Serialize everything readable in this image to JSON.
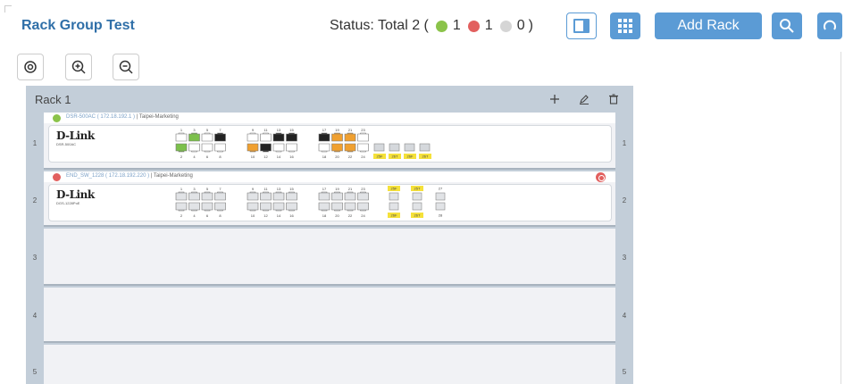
{
  "header": {
    "title": "Rack Group Test",
    "status_label": "Status: Total 2 (",
    "status_green_count": "1",
    "status_red_count": "1",
    "status_gray_count": "0",
    "status_close": ")",
    "add_rack_label": "Add Rack"
  },
  "colors": {
    "accent": "#5b9bd5",
    "title": "#2f6fa8",
    "status_green": "#8bc34a",
    "status_red": "#e2605f",
    "status_gray": "#d5d5d5",
    "port_green": "#7cc04b",
    "port_orange": "#f0a030",
    "port_black": "#222222",
    "port_yellow": "#f5e13a"
  },
  "rack": {
    "title": "Rack 1",
    "slots": [
      {
        "number": "1",
        "device": {
          "status": "green",
          "name": "DSR-500AC",
          "ip": "( 172.18.192.1 )",
          "separator": "|",
          "location": "Taipei-Marketing",
          "brand": "D-Link",
          "model": "DSR-500AC",
          "top_labels": [
            "1",
            "3",
            "5",
            "7",
            "9",
            "11",
            "13",
            "15",
            "17",
            "19",
            "21",
            "23"
          ],
          "bottom_labels": [
            "2",
            "4",
            "6",
            "8",
            "10",
            "12",
            "14",
            "16",
            "18",
            "20",
            "22",
            "24"
          ],
          "top_ports": [
            "empty",
            "green",
            "empty",
            "black",
            "empty",
            "empty",
            "black",
            "black",
            "black",
            "orange",
            "orange",
            "empty"
          ],
          "bottom_ports": [
            "green",
            "empty",
            "empty",
            "empty",
            "orange",
            "black",
            "empty",
            "empty",
            "empty",
            "orange",
            "orange",
            "empty"
          ],
          "sfp_labels": [
            "25F",
            "26T",
            "26F",
            "26T"
          ]
        }
      },
      {
        "number": "2",
        "device": {
          "status": "red",
          "name": "END_SW_1228",
          "ip": "( 172.18.192.220 )",
          "separator": "|",
          "location": "Taipei-Marketing",
          "brand": "D-Link",
          "model": "DGS-1228PoE",
          "top_labels": [
            "1",
            "3",
            "5",
            "7",
            "9",
            "11",
            "13",
            "15",
            "17",
            "19",
            "21",
            "23"
          ],
          "bottom_labels": [
            "2",
            "4",
            "6",
            "8",
            "10",
            "12",
            "14",
            "16",
            "18",
            "20",
            "22",
            "24"
          ],
          "sfp_top_labels": [
            "25F",
            "25T",
            "27"
          ],
          "sfp_bottom_labels": [
            "26F",
            "26T",
            "28"
          ]
        }
      },
      {
        "number": "3"
      },
      {
        "number": "4"
      },
      {
        "number": "5"
      }
    ]
  },
  "icons": {
    "view": "panel-view-icon",
    "grid": "grid-view-icon",
    "search": "search-icon",
    "refresh": "refresh-icon",
    "locate": "locate-icon",
    "zoom_in": "zoom-in-icon",
    "zoom_out": "zoom-out-icon",
    "rack_add": "plus-icon",
    "rack_edit": "pencil-icon",
    "rack_delete": "trash-icon"
  }
}
